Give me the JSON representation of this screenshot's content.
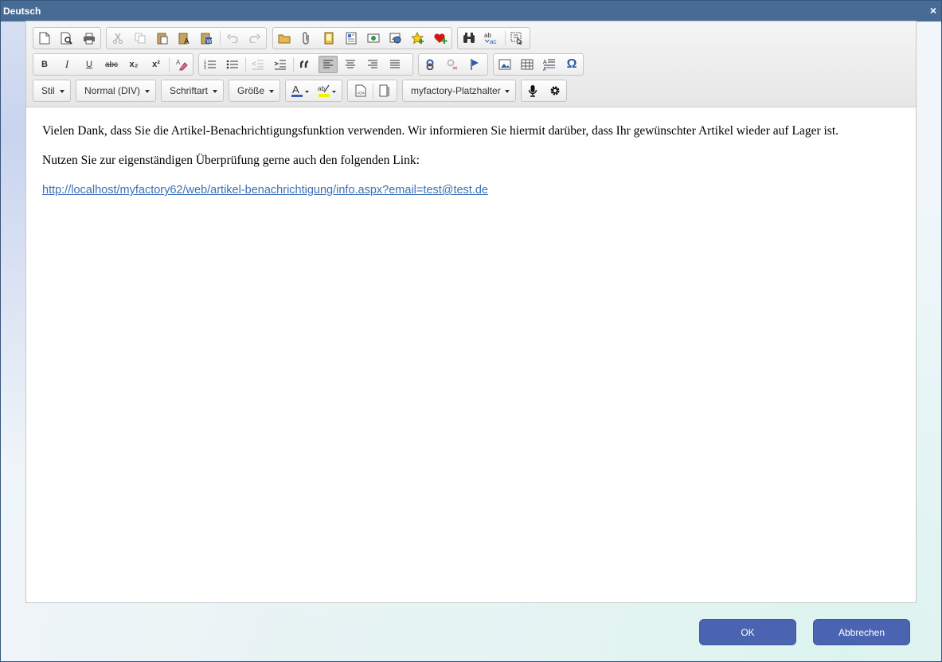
{
  "window": {
    "title": "Deutsch",
    "close_symbol": "×"
  },
  "toolbar": {
    "row1": [
      [
        "new-page-icon",
        "preview-icon",
        "print-icon"
      ],
      [
        "cut-icon",
        "copy-icon",
        "paste-icon",
        "paste-text-icon",
        "paste-word-icon",
        "undo-icon",
        "redo-icon"
      ],
      [
        "open-folder-icon",
        "attachment-icon",
        "template-icon",
        "document-properties-icon",
        "insert-media-icon",
        "insert-picture-icon",
        "add-favorite-icon",
        "favorite-heart-icon"
      ],
      [
        "find-icon",
        "spellcheck-icon",
        "select-all-icon"
      ]
    ],
    "row2_format": {
      "bold": "B",
      "italic": "I",
      "underline": "U",
      "strike": "abc",
      "subscript": "x₂",
      "superscript": "x²"
    },
    "row3": {
      "style_label": "Stil",
      "format_label": "Normal (DIV)",
      "font_label": "Schriftart",
      "size_label": "Größe",
      "placeholder_label": "myfactory-Platzhalter"
    },
    "special_char": "Ω"
  },
  "content": {
    "paragraph1": "Vielen Dank, dass Sie die Artikel-Benachrichtigungsfunktion verwenden. Wir informieren Sie hiermit darüber, dass Ihr gewünschter Artikel wieder auf Lager ist.",
    "paragraph2": "Nutzen Sie zur eigenständigen Überprüfung gerne auch den folgenden Link:",
    "link": "http://localhost/myfactory62/web/artikel-benachrichtigung/info.aspx?email=test@test.de"
  },
  "buttons": {
    "ok": "OK",
    "cancel": "Abbrechen"
  },
  "colors": {
    "titlebar": "#486b95",
    "button": "#4a64b2",
    "link": "#3b6fb6",
    "text_color_bar": "#3a5fb5",
    "highlight_bar": "#f2f200"
  }
}
